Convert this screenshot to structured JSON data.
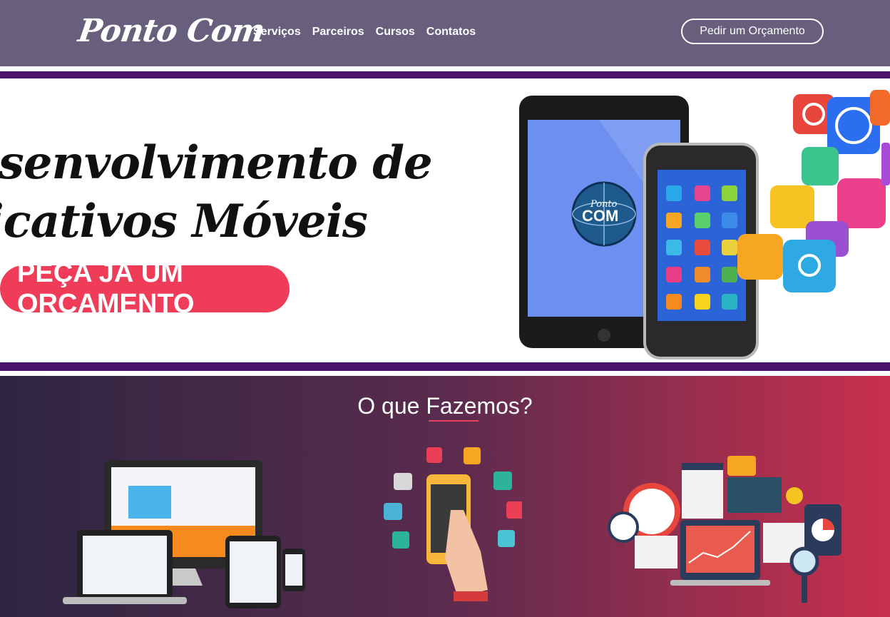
{
  "header": {
    "logo_text": "Ponto Com",
    "nav": [
      {
        "label": "Serviços"
      },
      {
        "label": "Parceiros"
      },
      {
        "label": "Cursos"
      },
      {
        "label": "Contatos"
      }
    ],
    "cta_label": "Pedir um Orçamento"
  },
  "hero": {
    "title_line1": "esenvolvimento de",
    "title_line2": "licativos Móveis",
    "button_label": "PEÇA JÁ UM ORÇAMENTO",
    "tablet_logo_line1": "Ponto",
    "tablet_logo_line2": "COM"
  },
  "section": {
    "title": "O que Fazemos?"
  },
  "colors": {
    "header_bg": "#675f7c",
    "accent_purple": "#4b136b",
    "cta_red": "#ef3c59"
  }
}
